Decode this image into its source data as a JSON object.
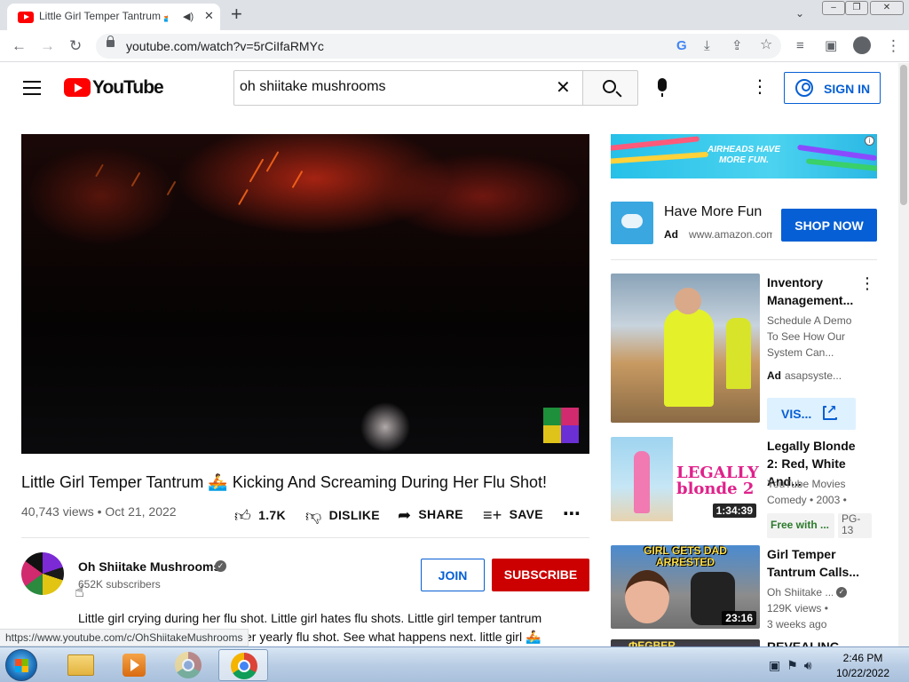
{
  "browser": {
    "tab_title": "Little Girl Temper Tantrum 🚣 Kicking And Screaming...",
    "audio_icon": "speaker-icon",
    "close_glyph": "✕",
    "new_tab_glyph": "+",
    "url": "youtube.com/watch?v=5rCiIfaRMYc",
    "toolbar_icons": [
      "back-icon",
      "forward-icon",
      "reload-icon",
      "google-lens-icon",
      "install-icon",
      "share-icon",
      "bookmark-star-icon",
      "media-controls-icon",
      "side-panel-icon",
      "profile-icon",
      "menu-icon"
    ]
  },
  "header": {
    "logo_text": "YouTube",
    "search_value": "oh shiitake mushrooms",
    "sign_in_label": "SIGN IN"
  },
  "video": {
    "title": "Little Girl Temper Tantrum 🚣 Kicking And Screaming During Her Flu Shot!",
    "views_date": "40,743 views • Oct 21, 2022",
    "likes": "1.7K",
    "dislike_label": "DISLIKE",
    "share_label": "SHARE",
    "save_label": "SAVE"
  },
  "channel": {
    "name": "Oh Shiitake Mushrooms",
    "subscribers": "652K subscribers",
    "join_label": "JOIN",
    "subscribe_label": "SUBSCRIBE"
  },
  "description": {
    "line1": "Little girl crying during her flu shot. Little girl hates flu shots. Little girl temper tantrum",
    "line2": "er yearly flu shot. See what happens next. little girl 🚣"
  },
  "status_bar_url": "https://www.youtube.com/c/OhShiitakeMushrooms",
  "sidebar": {
    "banner_text": "AIRHEADS HAVE MORE FUN.",
    "ad": {
      "headline": "Have More Fun",
      "label": "Ad",
      "url": "www.amazon.com",
      "cta": "SHOP NOW"
    },
    "recommendations": [
      {
        "title": "Inventory Management...",
        "meta1": "Schedule A Demo",
        "meta2": "To See How Our",
        "meta3": "System Can...",
        "ad_label": "Ad",
        "advertiser": "asapsyste...",
        "cta": "VIS..."
      },
      {
        "title": "Legally Blonde 2: Red, White And...",
        "thumb_text": "LEGALLY blonde 2",
        "channel": "YouTube Movies",
        "meta": "Comedy • 2003 •",
        "duration": "1:34:39",
        "free_label": "Free with ...",
        "rating": "PG-13"
      },
      {
        "title": "Girl Temper Tantrum Calls...",
        "thumb_text": "GIRL GETS DAD ARRESTED",
        "channel": "Oh Shiitake ...",
        "views": "129K views •",
        "age": "3 weeks ago",
        "duration": "23:16"
      },
      {
        "title": "REVEALING MY...",
        "thumb_text": "ФEGBER"
      }
    ]
  },
  "taskbar": {
    "time": "2:46 PM",
    "date": "10/22/2022",
    "apps": [
      "windows-explorer",
      "media-player",
      "chrome",
      "chrome"
    ]
  },
  "colors": {
    "youtube_red": "#ff0000",
    "subscribe_red": "#cc0000",
    "link_blue": "#065fd4"
  }
}
